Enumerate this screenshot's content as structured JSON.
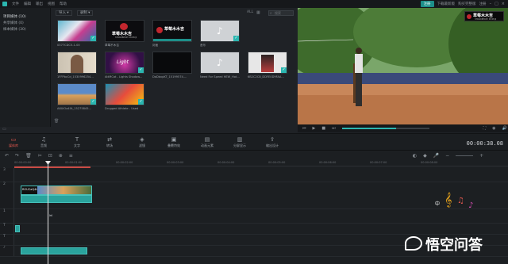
{
  "menubar": {
    "items": [
      "文件",
      "编辑",
      "输出",
      "视图",
      "帮助"
    ],
    "register": "注册",
    "links": [
      "下载最新版",
      "购买完整版",
      "注册"
    ]
  },
  "left_panel": {
    "items": [
      {
        "label": "项目媒体 (10)",
        "active": true
      },
      {
        "label": "共享媒体 (0)",
        "active": false
      },
      {
        "label": "样本媒体 (30)",
        "active": false
      }
    ]
  },
  "media": {
    "import_label": "导入",
    "record_label": "录制",
    "filter_label": "ALL",
    "search_placeholder": "搜索",
    "thumbs": [
      {
        "caption": "0377CDC5-1-00"
      },
      {
        "caption": "草莓不木吉"
      },
      {
        "caption": "封面"
      },
      {
        "caption": "音乐"
      },
      {
        "caption": "1FFPbcCd_1530996254..."
      },
      {
        "caption": "AttMCat - Lights Shadow..."
      },
      {
        "caption": "DaDbxpKT_15199574...."
      },
      {
        "caption": "Need For Speed HEW_Hot..."
      },
      {
        "caption": "6B2C2C8_DDFE0D9FAA..."
      },
      {
        "caption": "A6UiOa40t_15275845..."
      },
      {
        "caption": "Drugged Athlete - Used"
      }
    ],
    "card_title_red": "草莓木木吉",
    "card_sub": "STRAWBERRY MUMUJI"
  },
  "preview": {
    "watermark": "草莓木木吉",
    "watermark_sub": "STRAWBERRY MUMUJI",
    "progress": 0.62
  },
  "toolbar": {
    "items": [
      "媒体库",
      "音频",
      "文字",
      "转场",
      "滤镜",
      "叠覆特效",
      "动画元素",
      "分屏显示",
      "输出设计"
    ],
    "timecode": "00:00:38.08"
  },
  "timeline": {
    "ruler": [
      "00:00:00:00",
      "00:00:01:00",
      "00:00:02:00",
      "00:00:03:00",
      "00:00:04:00",
      "00:00:05:00",
      "00:00:06:00",
      "00:00:07:00",
      "00:00:08:00"
    ],
    "tracks": [
      "3",
      "2",
      "1",
      "T",
      "T",
      "♪"
    ],
    "clip1_label": "ROUCaQ4t"
  },
  "brand": {
    "name": "悟空问答",
    "accent": "#2bb6b0",
    "active_tab": "#e4584f"
  }
}
